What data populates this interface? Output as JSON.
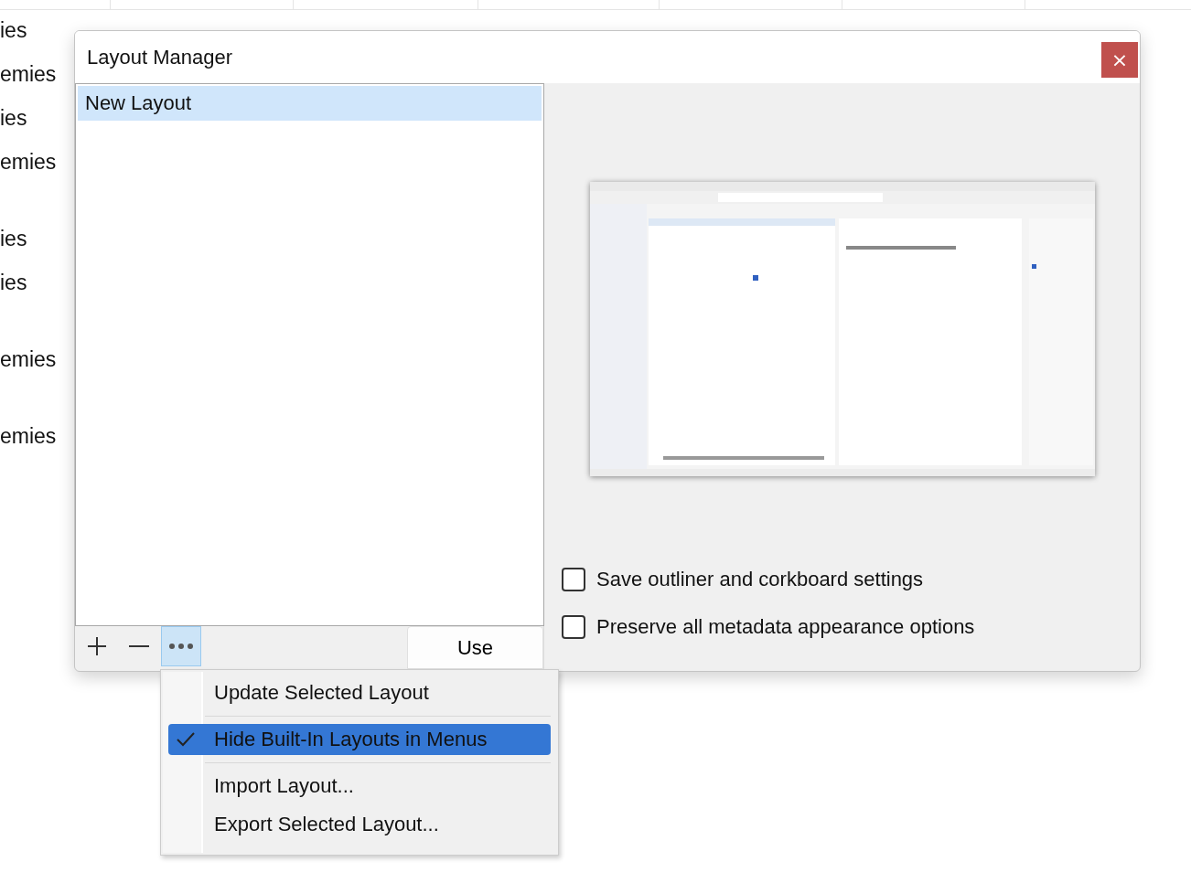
{
  "background_table": {
    "rows": [
      {
        "cells": [
          "ies"
        ]
      },
      {
        "cells": [
          "emies"
        ]
      },
      {
        "cells": [
          "ies"
        ]
      },
      {
        "cells": [
          "emies"
        ]
      },
      {
        "cells": [
          "ies"
        ]
      },
      {
        "cells": [
          "ies"
        ]
      },
      {
        "cells": [
          "emies"
        ]
      },
      {
        "cells": [
          "emies"
        ]
      }
    ]
  },
  "dialog": {
    "title": "Layout Manager",
    "close_button": "×",
    "layouts": [
      {
        "label": "New Layout",
        "selected": true
      }
    ],
    "toolbar": {
      "more_pressed": true,
      "use_button": "Use"
    },
    "options": [
      {
        "label": "Save outliner and corkboard settings",
        "checked": false
      },
      {
        "label": "Preserve all metadata appearance options",
        "checked": false
      }
    ]
  },
  "menu": {
    "items": [
      {
        "kind": "item",
        "label": "Update Selected Layout",
        "checked": false,
        "selected": false
      },
      {
        "kind": "separator"
      },
      {
        "kind": "item",
        "label": "Hide Built-In Layouts in Menus",
        "checked": true,
        "selected": true
      },
      {
        "kind": "separator"
      },
      {
        "kind": "item",
        "label": "Import Layout...",
        "checked": false,
        "selected": false
      },
      {
        "kind": "item",
        "label": "Export Selected Layout...",
        "checked": false,
        "selected": false
      }
    ]
  }
}
